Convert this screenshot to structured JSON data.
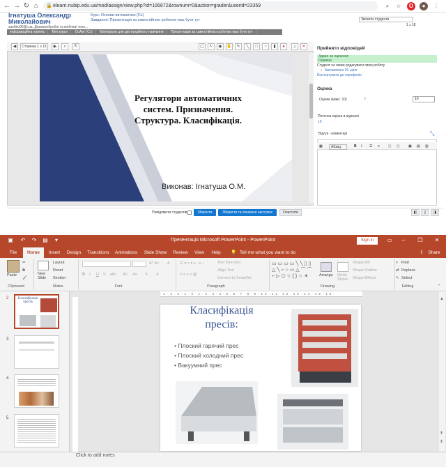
{
  "browser": {
    "url": "elearn.nubip.edu.ua/mod/assign/view.php?id=195872&rownum=0&action=grader&userid=23359",
    "user_name_line1": "Ігнатуша Олександр",
    "user_name_line2": "Миколайович",
    "user_email": "sashko00@i.ua, Деревообробні та меблеві техн...",
    "course": "Курс: Основи автоматики (Сх)",
    "task": "Завдання: Презентація за самостійною роботою має бути тут",
    "student_select": "Змінити студента",
    "page_count": "1 з 18",
    "breadcrumb": [
      "Інформаційна панель",
      "Мої курси",
      "ОсАвт (Сх)",
      "Матеріали для дистанційного навчання",
      "Презентація за самостійною роботою має бути тут"
    ],
    "viewer": {
      "page_label": "Сторінка 1 з 13"
    },
    "slide1": {
      "title_l1": "Регулятори автоматичних",
      "title_l2": "систем. Призначення.",
      "title_l3": "Структура. Класифікація.",
      "author": "Виконав: Ігнатуша О.М."
    },
    "panel": {
      "heading": "Прийнято відповідей",
      "status1": "Здано на оцінення",
      "status2": "Оцінено",
      "edit_note": "Студент не може редагувати свою роботу",
      "file": "Автоматика 26..pptx",
      "export": "Експортувати до портфоліо",
      "grade_heading": "Оцінка",
      "grade_label": "Оцінка (макс. 10)",
      "grade_value": "10",
      "journal_label": "Поточна оцінка в журналі",
      "journal_value": "10",
      "feedback_label": "Відгук - коментарі",
      "para_label": "Абзац"
    },
    "footer": {
      "notify": "Повідомити студентів",
      "save": "Зберегти",
      "save_next": "Зберегти та показати наступне",
      "reset": "Очистити"
    }
  },
  "ppt": {
    "window_title": "Презентація Microsoft PowerPoint  -  PowerPoint",
    "sign_in": "Sign in",
    "share": "Share",
    "tabs": [
      "File",
      "Home",
      "Insert",
      "Design",
      "Transitions",
      "Animations",
      "Slide Show",
      "Review",
      "View",
      "Help"
    ],
    "tell_me": "Tell me what you want to do",
    "groups": [
      "Clipboard",
      "Slides",
      "Font",
      "Paragraph",
      "Drawing",
      "Editing"
    ],
    "clipboard": {
      "paste": "Paste"
    },
    "slides_group": {
      "new_slide": "New Slide",
      "layout": "Layout",
      "reset": "Reset",
      "section": "Section"
    },
    "paragraph": {
      "text_direction": "Text Direction",
      "align_text": "Align Text",
      "convert": "Convert to SmartArt"
    },
    "drawing": {
      "arrange": "Arrange",
      "quick_styles": "Quick Styles",
      "shape_fill": "Shape Fill",
      "shape_outline": "Shape Outline",
      "shape_effects": "Shape Effects"
    },
    "editing": {
      "find": "Find",
      "replace": "Replace",
      "select": "Select"
    },
    "thumb_numbers": [
      "2",
      "3",
      "4",
      "5",
      "6"
    ],
    "thumb2_title": "Класифікація пресів",
    "slide2": {
      "title_l1": "Класифікація",
      "title_l2": "пресів:",
      "bullets": [
        "Плоский гарячий прес",
        "Плоский холодний прес",
        "Вакуумний прес"
      ]
    },
    "notes": "Click to add notes"
  },
  "colors": {
    "ppt_accent": "#b7472a",
    "moodle_blue": "#1177d1",
    "slide_title": "#3b5594"
  }
}
